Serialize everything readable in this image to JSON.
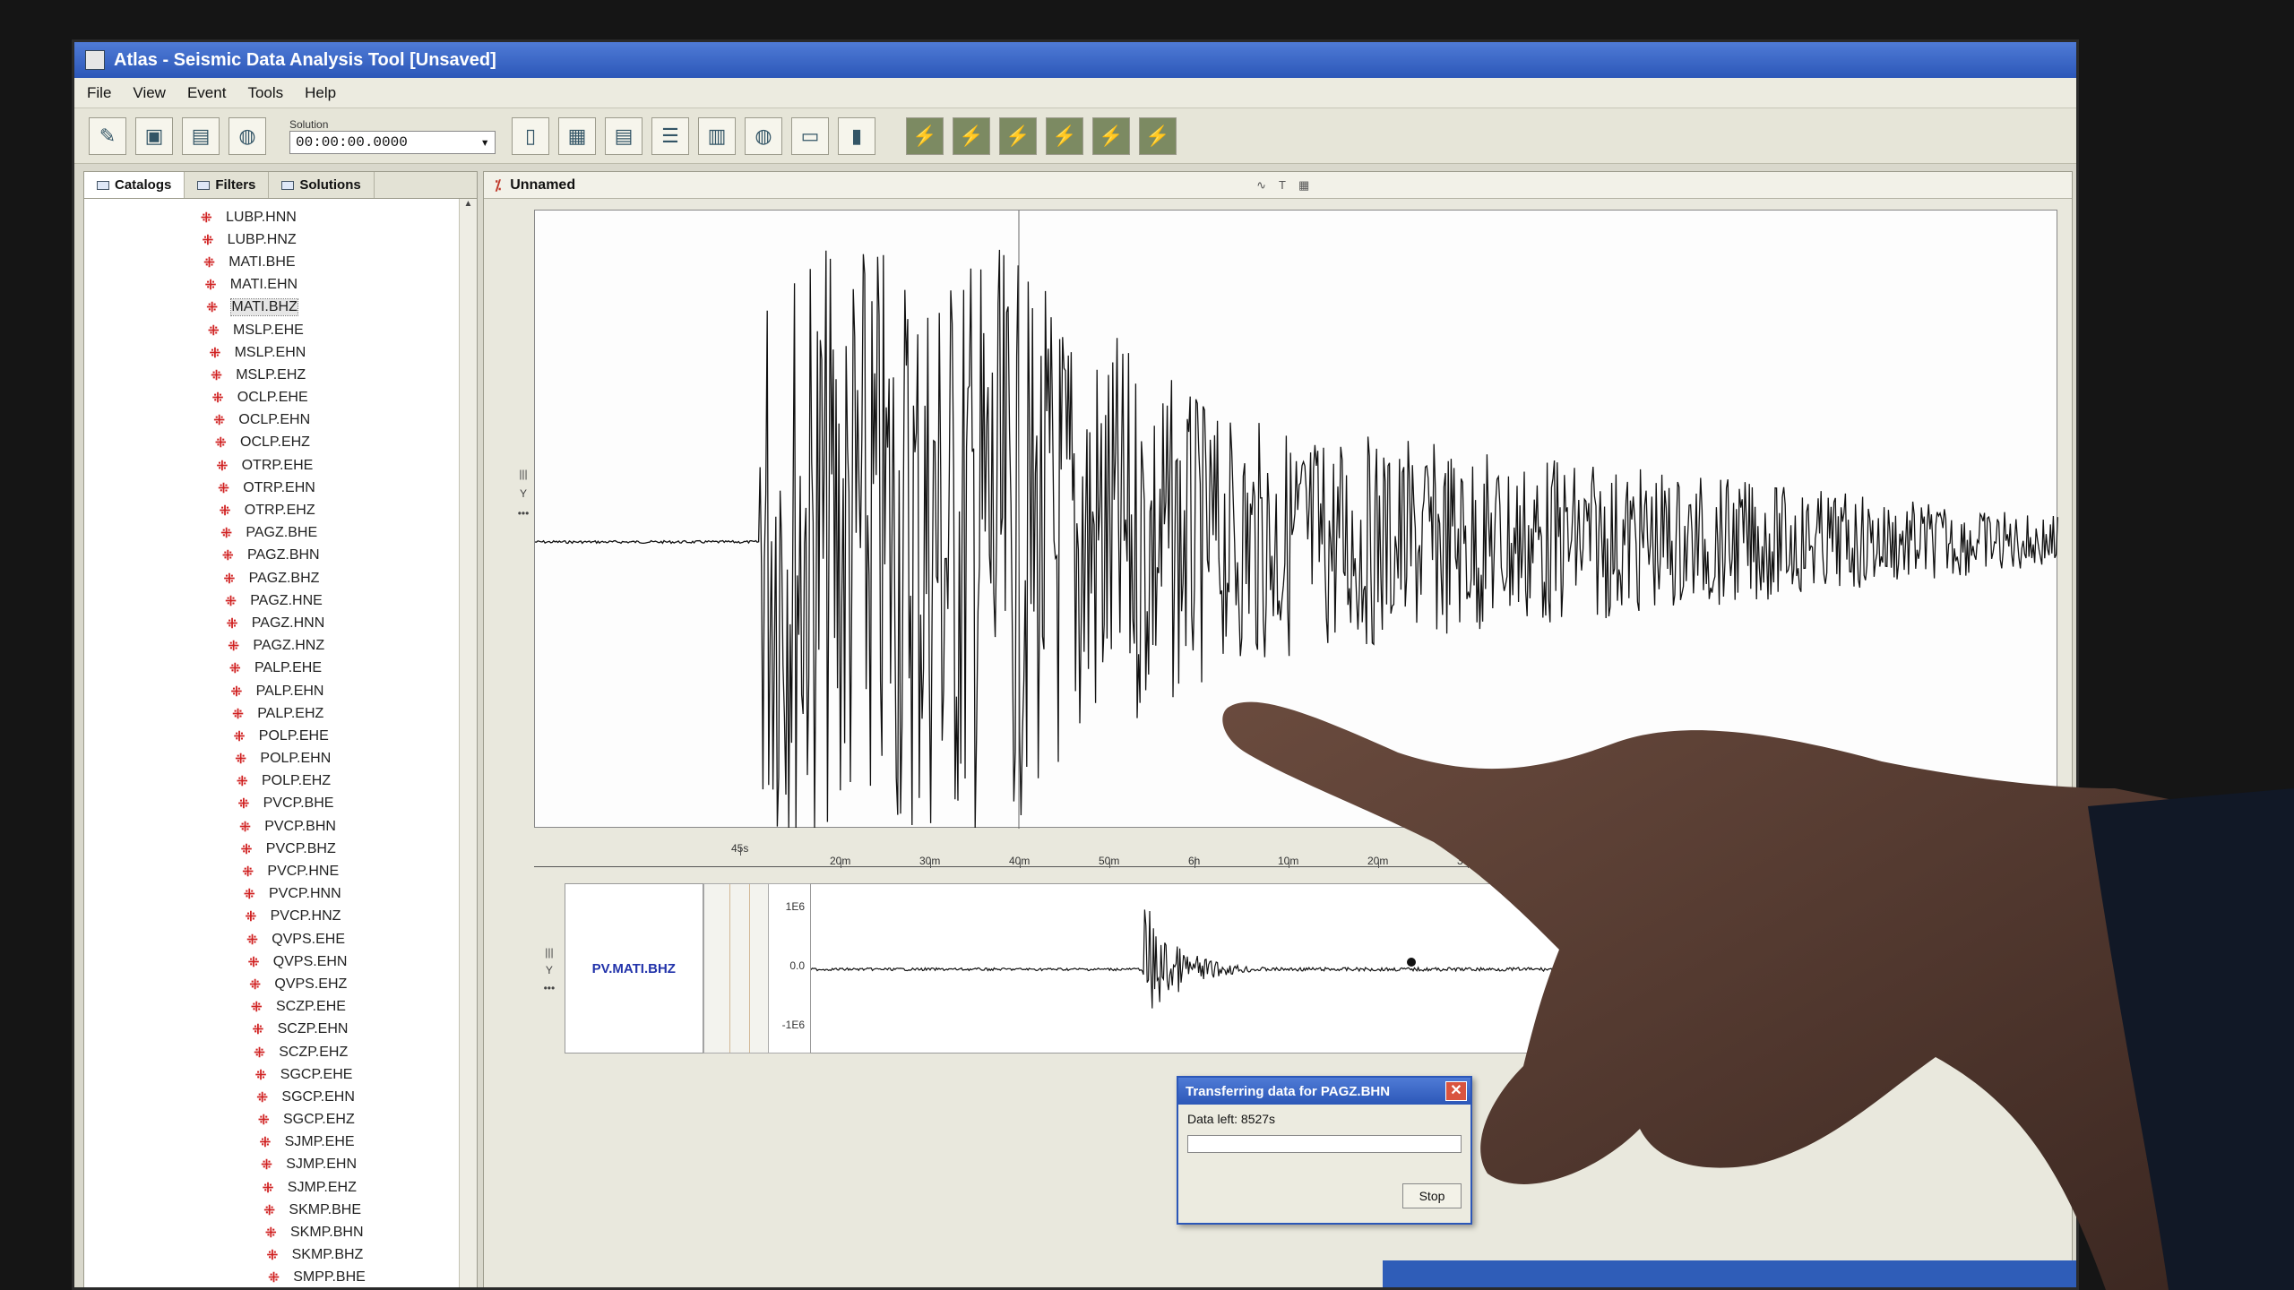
{
  "window": {
    "title": "Atlas - Seismic Data Analysis Tool [Unsaved]"
  },
  "menu": [
    "File",
    "View",
    "Event",
    "Tools",
    "Help"
  ],
  "toolbar": {
    "solution_label": "Solution",
    "solution_value": "00:00:00.0000",
    "left_icons": [
      "new-event-icon",
      "save-icon",
      "open-icon",
      "globe-icon"
    ],
    "doc_icons": [
      "page-icon",
      "filter-icon",
      "table-icon",
      "list-icon",
      "notes-icon",
      "globe-icon",
      "folder-icon",
      "trash-icon"
    ],
    "trace_icons": [
      "trace-icon-1",
      "trace-icon-2",
      "trace-icon-3",
      "trace-icon-4",
      "trace-icon-5",
      "trace-icon-6"
    ]
  },
  "left_tabs": [
    "Catalogs",
    "Filters",
    "Solutions"
  ],
  "stations": [
    "LUBP.HNN",
    "LUBP.HNZ",
    "MATI.BHE",
    "MATI.EHN",
    "MATI.BHZ",
    "MSLP.EHE",
    "MSLP.EHN",
    "MSLP.EHZ",
    "OCLP.EHE",
    "OCLP.EHN",
    "OCLP.EHZ",
    "OTRP.EHE",
    "OTRP.EHN",
    "OTRP.EHZ",
    "PAGZ.BHE",
    "PAGZ.BHN",
    "PAGZ.BHZ",
    "PAGZ.HNE",
    "PAGZ.HNN",
    "PAGZ.HNZ",
    "PALP.EHE",
    "PALP.EHN",
    "PALP.EHZ",
    "POLP.EHE",
    "POLP.EHN",
    "POLP.EHZ",
    "PVCP.BHE",
    "PVCP.BHN",
    "PVCP.BHZ",
    "PVCP.HNE",
    "PVCP.HNN",
    "PVCP.HNZ",
    "QVPS.EHE",
    "QVPS.EHN",
    "QVPS.EHZ",
    "SCZP.EHE",
    "SCZP.EHN",
    "SCZP.EHZ",
    "SGCP.EHE",
    "SGCP.EHN",
    "SGCP.EHZ",
    "SJMP.EHE",
    "SJMP.EHN",
    "SJMP.EHZ",
    "SKMP.BHE",
    "SKMP.BHN",
    "SKMP.BHZ",
    "SMPP.BHE"
  ],
  "selected_station": "MATI.BHZ",
  "document": {
    "tab": "Unnamed"
  },
  "trace_side_buttons": [
    "|||",
    "Y",
    "•••"
  ],
  "time_axis": {
    "ticks": [
      "45s",
      "20m",
      "30m",
      "40m",
      "50m",
      "6h",
      "10m",
      "20m",
      "30m"
    ]
  },
  "overview": {
    "label": "PV.MATI.BHZ",
    "scale": [
      "1E6",
      "0.0",
      "-1E6"
    ]
  },
  "dialog": {
    "title": "Transferring data for PAGZ.BHN",
    "text": "Data left: 8527s",
    "button": "Stop"
  },
  "colors": {
    "titlebar": "#2c57b8",
    "station_icon": "#d02020",
    "trace": "#111111",
    "overview_label": "#2233aa"
  }
}
